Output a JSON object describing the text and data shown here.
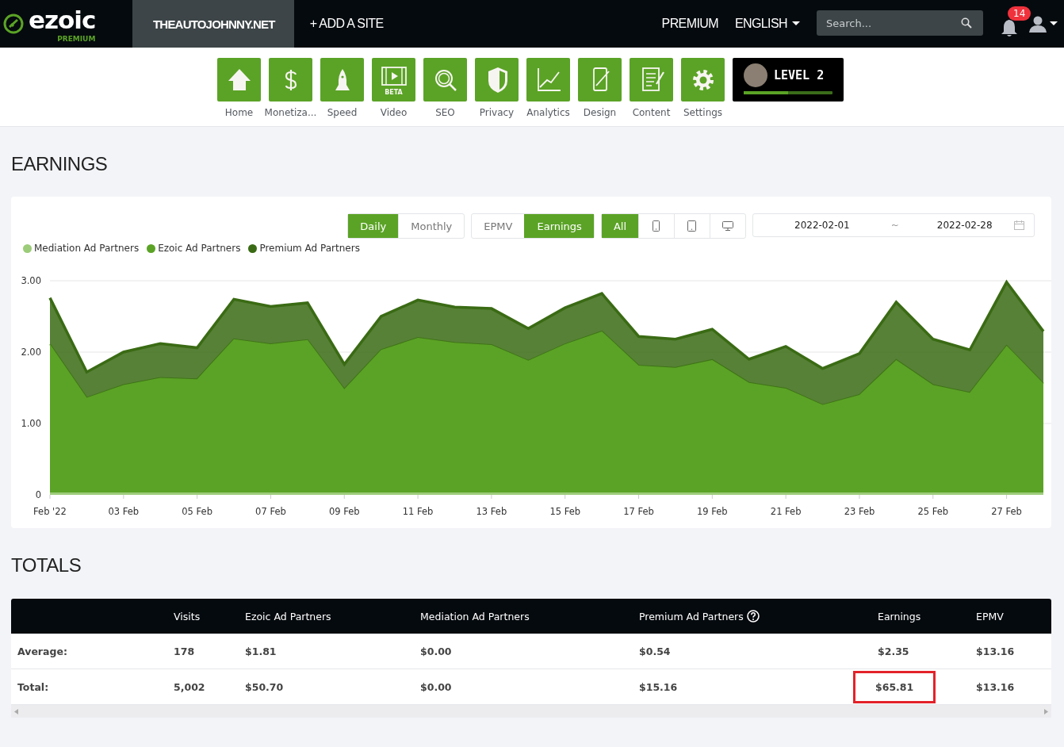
{
  "topbar": {
    "logo": {
      "name": "ezoic",
      "tier": "PREMIUM"
    },
    "sites": [
      {
        "label": "THEAUTOJOHNNY.NET",
        "selected": true
      }
    ],
    "add_site": "+ ADD A SITE",
    "premium": "PREMIUM",
    "language": "ENGLISH",
    "search": {
      "placeholder": "Search..."
    },
    "notifications": "14"
  },
  "toolbar": {
    "items": [
      {
        "kind": "home",
        "label": "Home"
      },
      {
        "kind": "dollar",
        "label": "Monetiza..."
      },
      {
        "kind": "rocket",
        "label": "Speed"
      },
      {
        "kind": "video",
        "label": "Video",
        "badge": "BETA"
      },
      {
        "kind": "search",
        "label": "SEO"
      },
      {
        "kind": "shield",
        "label": "Privacy"
      },
      {
        "kind": "chart",
        "label": "Analytics"
      },
      {
        "kind": "phone",
        "label": "Design"
      },
      {
        "kind": "document",
        "label": "Content"
      },
      {
        "kind": "gear",
        "label": "Settings"
      }
    ],
    "level": {
      "label": "LEVEL 2",
      "level": 0.5
    }
  },
  "earnings": {
    "title": "EARNINGS",
    "controls": [
      [
        {
          "kind": "text",
          "label": "Daily",
          "selected": true
        },
        {
          "kind": "text",
          "label": "Monthly",
          "selected": false
        }
      ],
      [
        {
          "kind": "text",
          "label": "EPMV",
          "selected": false
        },
        {
          "kind": "text",
          "label": "Earnings",
          "selected": true
        }
      ],
      [
        {
          "kind": "text",
          "label": "All",
          "selected": true
        },
        {
          "kind": "phone",
          "selected": false
        },
        {
          "kind": "tablet",
          "selected": false
        },
        {
          "kind": "desktop",
          "selected": false
        }
      ]
    ],
    "date_range": {
      "start": "2022-02-01",
      "separator": "~",
      "end": "2022-02-28"
    },
    "chart_data": {
      "type": "area",
      "stacked": true,
      "categories": [
        "Feb '22",
        null,
        "03 Feb",
        null,
        "05 Feb",
        null,
        "07 Feb",
        null,
        "09 Feb",
        null,
        "11 Feb",
        null,
        "13 Feb",
        null,
        "15 Feb",
        null,
        "17 Feb",
        null,
        "19 Feb",
        null,
        "21 Feb",
        null,
        "23 Feb",
        null,
        "25 Feb",
        null,
        "27 Feb",
        null
      ],
      "ylim": [
        0,
        3
      ],
      "yticks": [
        {
          "value": 0,
          "label": "0"
        },
        {
          "value": 1,
          "label": "1.00"
        },
        {
          "value": 2,
          "label": "2.00"
        },
        {
          "value": 3,
          "label": "3.00"
        }
      ],
      "series": [
        {
          "name": "Mediation Ad Partners",
          "color": "#9ccc79",
          "values": [
            0.03,
            0.03,
            0.03,
            0.03,
            0.03,
            0.03,
            0.03,
            0.03,
            0.03,
            0.03,
            0.03,
            0.03,
            0.03,
            0.03,
            0.03,
            0.03,
            0.03,
            0.03,
            0.03,
            0.03,
            0.03,
            0.03,
            0.03,
            0.03,
            0.03,
            0.03,
            0.03,
            0.03
          ]
        },
        {
          "name": "Ezoic Ad Partners",
          "color": "#5ba326",
          "values": [
            2.08,
            1.33,
            1.51,
            1.61,
            1.59,
            2.15,
            2.08,
            2.14,
            1.45,
            2.0,
            2.17,
            2.1,
            2.07,
            1.85,
            2.08,
            2.26,
            1.78,
            1.75,
            1.86,
            1.54,
            1.46,
            1.23,
            1.37,
            1.86,
            1.51,
            1.4,
            2.06,
            1.53
          ]
        },
        {
          "name": "Premium Ad Partners",
          "color": "#3a6b14",
          "values": [
            0.65,
            0.36,
            0.46,
            0.48,
            0.44,
            0.56,
            0.53,
            0.52,
            0.35,
            0.47,
            0.53,
            0.5,
            0.51,
            0.45,
            0.51,
            0.53,
            0.41,
            0.4,
            0.43,
            0.33,
            0.59,
            0.51,
            0.58,
            0.81,
            0.64,
            0.6,
            0.89,
            0.73
          ]
        }
      ]
    }
  },
  "totals": {
    "title": "TOTALS",
    "columns": [
      {
        "label": "Visits"
      },
      {
        "label": "Ezoic Ad Partners"
      },
      {
        "label": "Mediation Ad Partners"
      },
      {
        "label": "Premium Ad Partners",
        "help": true
      },
      {
        "label": "Earnings"
      },
      {
        "label": "EPMV"
      }
    ],
    "rows": [
      {
        "label": "Average:",
        "cells": [
          {
            "text": "178",
            "highlighted": false
          },
          {
            "text": "$1.81",
            "highlighted": false
          },
          {
            "text": "$0.00",
            "highlighted": false
          },
          {
            "text": "$0.54",
            "highlighted": false
          },
          {
            "text": "$2.35",
            "highlighted": false
          },
          {
            "text": "$13.16",
            "highlighted": false
          }
        ]
      },
      {
        "label": "Total:",
        "cells": [
          {
            "text": "5,002",
            "highlighted": false
          },
          {
            "text": "$50.70",
            "highlighted": false
          },
          {
            "text": "$0.00",
            "highlighted": false
          },
          {
            "text": "$15.16",
            "highlighted": false
          },
          {
            "text": "$65.81",
            "highlighted": true
          },
          {
            "text": "$13.16",
            "highlighted": false
          }
        ]
      }
    ]
  }
}
